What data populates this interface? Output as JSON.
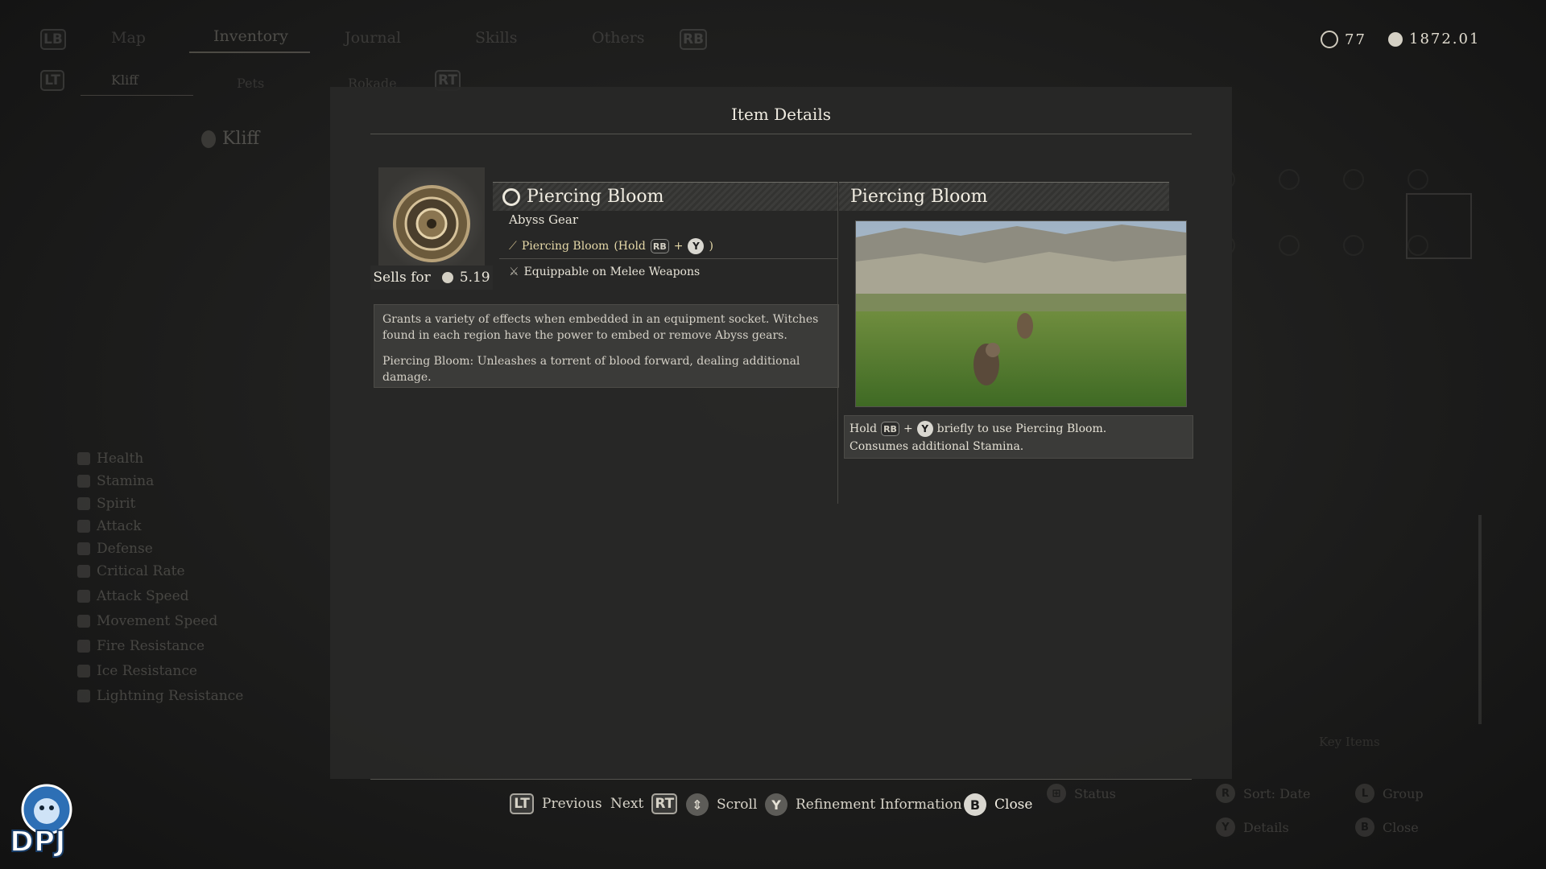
{
  "top_nav": {
    "lb": "LB",
    "rb": "RB",
    "tabs": [
      "Map",
      "Inventory",
      "Journal",
      "Skills",
      "Others"
    ],
    "active_tab": "Inventory"
  },
  "sub_nav": {
    "lt": "LT",
    "rt": "RT",
    "tabs": [
      "Kliff",
      "Pets",
      "Rokade"
    ]
  },
  "currency": {
    "abyss_count": "77",
    "silver": "1872.01"
  },
  "character": {
    "name": "Kliff",
    "stats": [
      "Health",
      "Stamina",
      "Spirit",
      "Attack",
      "Defense",
      "Critical Rate",
      "Attack Speed",
      "Movement Speed",
      "Fire Resistance",
      "Ice Resistance",
      "Lightning Resistance"
    ]
  },
  "modal": {
    "title": "Item Details",
    "sells_for_label": "Sells for",
    "sells_for_value": "5.19",
    "item_name": "Piercing Bloom",
    "item_type": "Abyss Gear",
    "skill_line_name": "Piercing Bloom",
    "skill_line_hold": "(Hold",
    "skill_line_end": ")",
    "equip_line": "Equippable on Melee Weapons",
    "description_1": "Grants a variety of effects when embedded in an equipment socket. Witches found in each region have the power to embed or remove Abyss gears.",
    "description_2": "Piercing Bloom: Unleashes a torrent of blood forward, dealing additional damage.",
    "skill_title": "Piercing Bloom",
    "skill_hint_hold": "Hold",
    "skill_hint_rest": "briefly to use Piercing Bloom.",
    "skill_hint_line2": "Consumes additional Stamina.",
    "rb": "RB",
    "y": "Y",
    "plus": "+"
  },
  "bottom_bar": {
    "lt": "LT",
    "previous": "Previous",
    "next": "Next",
    "rt": "RT",
    "scroll": "Scroll",
    "y": "Y",
    "refinement": "Refinement Information",
    "b": "B",
    "close": "Close"
  },
  "background_hints": {
    "status": "Status",
    "sort": "Sort: Date",
    "group": "Group",
    "details": "Details",
    "close": "Close",
    "key_items": "Key Items"
  },
  "watermark": "DPJ"
}
